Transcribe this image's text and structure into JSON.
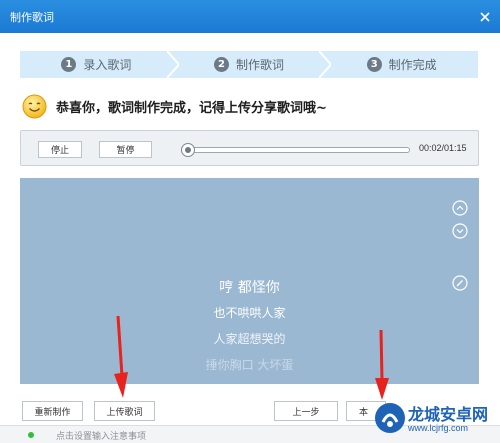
{
  "window": {
    "title": "制作歌词"
  },
  "steps": [
    {
      "num": "1",
      "label": "录入歌词"
    },
    {
      "num": "2",
      "label": "制作歌词"
    },
    {
      "num": "3",
      "label": "制作完成"
    }
  ],
  "congrats": {
    "message": "恭喜你，歌词制作完成，记得上传分享歌词哦~"
  },
  "player": {
    "stop_label": "停止",
    "pause_label": "暂停",
    "time": "00:02/01:15",
    "progress": 0.026
  },
  "preview": {
    "lines": [
      "哼 都怪你",
      "也不哄哄人家",
      "人家超想哭的",
      "捶你胸口 大坏蛋"
    ]
  },
  "bottom": {
    "remake_label": "重新制作",
    "upload_label": "上传歌词",
    "prev_label": "上一步",
    "local_label": "本"
  },
  "status": {
    "placeholder": "点击设置输入注意事项"
  },
  "watermark": {
    "title": "龙城安卓网",
    "url": "www.lcjrfg.com"
  },
  "colors": {
    "titlebar": "#1b7ad3",
    "steps_bg": "#d7ecfb",
    "preview_bg": "#9bb8d2",
    "arrow": "#e8231e"
  }
}
